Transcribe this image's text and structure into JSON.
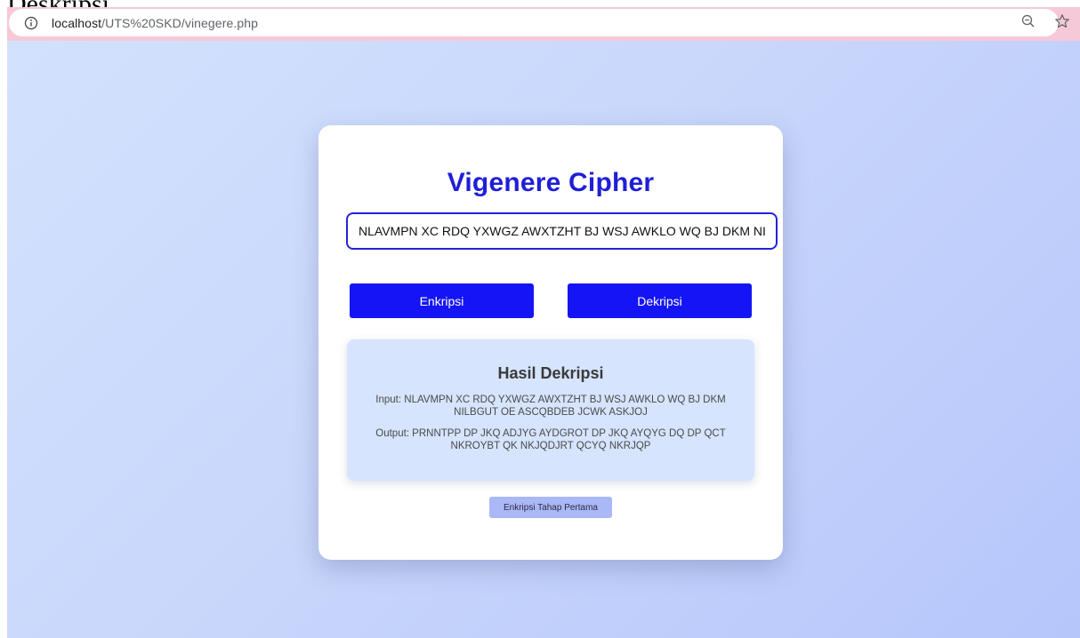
{
  "page": {
    "heading": "Deskripsi"
  },
  "browser": {
    "url_host": "localhost",
    "url_path": "/UTS%20SKD/vinegere.php",
    "icons": [
      "info-icon",
      "zoom-out-icon",
      "bookmark-star-icon"
    ]
  },
  "card": {
    "title": "Vigenere Cipher",
    "input_value": "NLAVMPN XC RDQ YXWGZ AWXTZHT BJ WSJ AWKLO WQ BJ DKM NILBGUT OE ASCQBDEB JCWK ASKJOJ",
    "encrypt_label": "Enkripsi",
    "decrypt_label": "Dekripsi",
    "result": {
      "title": "Hasil Dekripsi",
      "input_line": "Input: NLAVMPN XC RDQ YXWGZ AWXTZHT BJ WSJ AWKLO WQ BJ DKM NILBGUT OE ASCQBDEB JCWK ASKJOJ",
      "output_line": "Output: PRNNTPP DP JKQ ADJYG AYDGROT DP JKQ AYQYG DQ DP QCT NKROYBT QK NKJQDJRT QCYQ NKRJQP"
    },
    "first_stage_label": "Enkripsi Tahap Pertama"
  },
  "colors": {
    "accent": "#1414f5",
    "title": "#1f1fd8",
    "browser_bar": "#f6c9d8",
    "result_bg": "#d6e4fd",
    "secondary_button": "#aab8f7"
  }
}
